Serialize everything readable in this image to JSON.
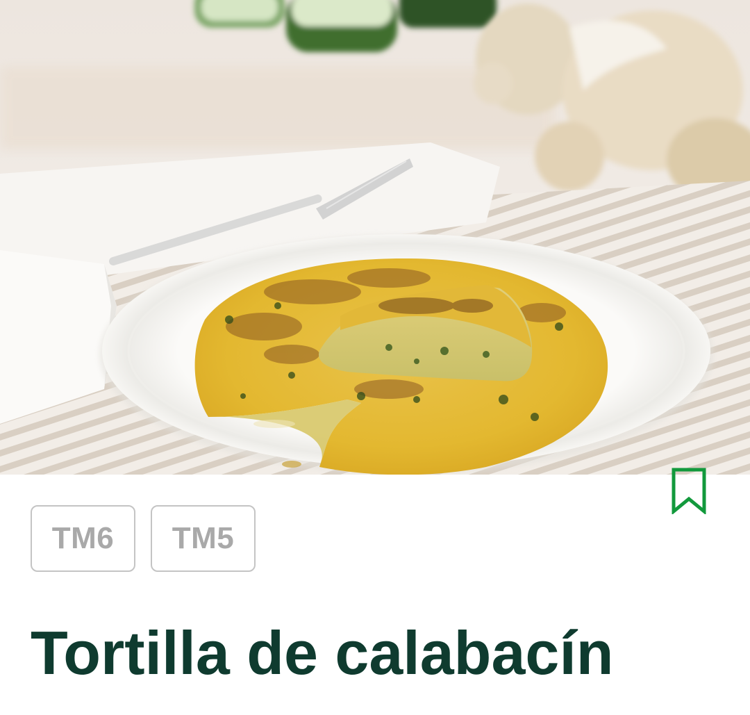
{
  "recipe": {
    "title": "Tortilla de calabacín",
    "image_alt": "Tortilla de calabacín"
  },
  "devices": [
    {
      "label": "TM6"
    },
    {
      "label": "TM5"
    }
  ],
  "bookmark": {
    "icon": "bookmark-icon",
    "color": "#12993c"
  },
  "colors": {
    "title": "#0f3b2f",
    "chip_text": "#a9a9a9",
    "chip_border": "#c4c4c4",
    "accent": "#12993c"
  }
}
